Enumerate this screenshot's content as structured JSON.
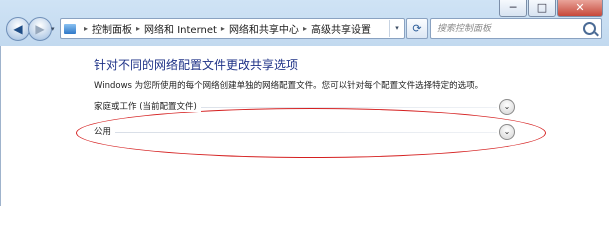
{
  "window": {
    "controls": {
      "minimize": "─",
      "maximize": "□",
      "close": "✕"
    }
  },
  "nav": {
    "back_glyph": "◀",
    "forward_glyph": "▶",
    "dropdown_glyph": "▾"
  },
  "address": {
    "crumbs": [
      "控制面板",
      "网络和 Internet",
      "网络和共享中心",
      "高级共享设置"
    ],
    "separator": "▸",
    "dropdown_glyph": "▾"
  },
  "refresh_glyph": "⟳",
  "search": {
    "placeholder": "搜索控制面板"
  },
  "main": {
    "title": "针对不同的网络配置文件更改共享选项",
    "description": "Windows 为您所使用的每个网络创建单独的网络配置文件。您可以针对每个配置文件选择特定的选项。",
    "profiles": [
      {
        "label": "家庭或工作 (当前配置文件)",
        "expand_glyph": "⌄"
      },
      {
        "label": "公用",
        "expand_glyph": "⌄"
      }
    ]
  },
  "colors": {
    "title": "#1e3287",
    "annotation": "#d52020",
    "chrome": "#c2d9ef"
  }
}
